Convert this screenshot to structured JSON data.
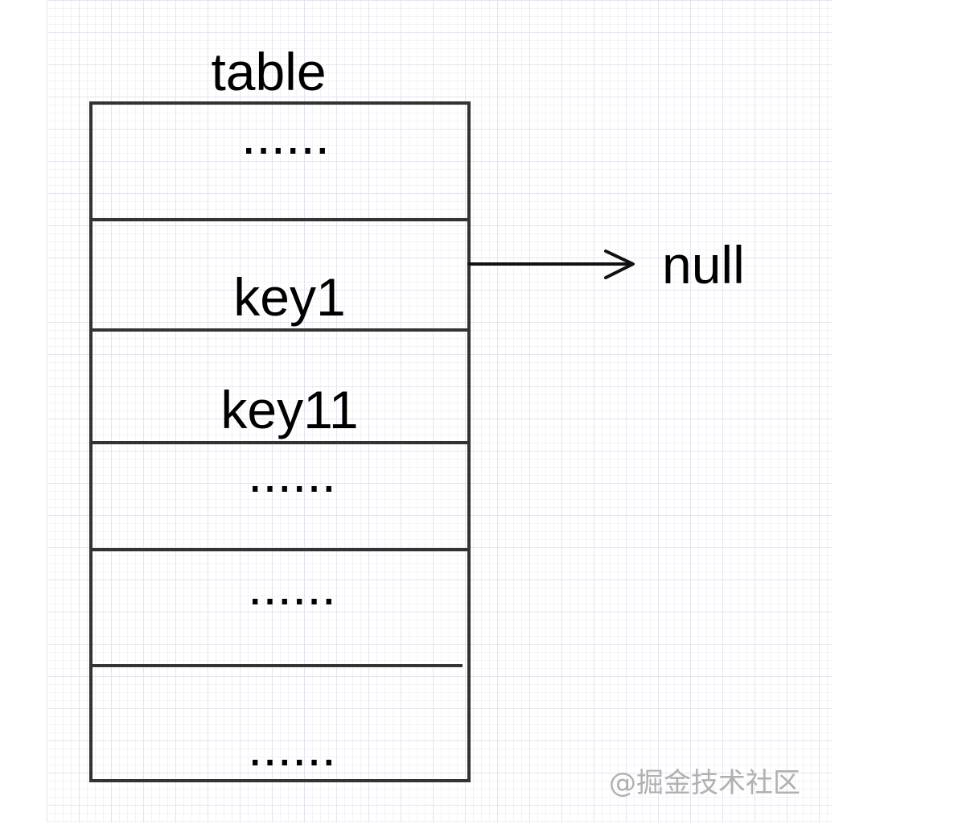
{
  "table": {
    "title": "table",
    "cells": [
      "......",
      "key1",
      "key11",
      "......",
      "......",
      "......"
    ]
  },
  "pointer": {
    "target": "null"
  },
  "watermark": "@掘金技术社区",
  "colors": {
    "stroke": "#333333",
    "text": "#000000",
    "grid": "#e4e4ef",
    "watermark": "#b0b0b0"
  }
}
